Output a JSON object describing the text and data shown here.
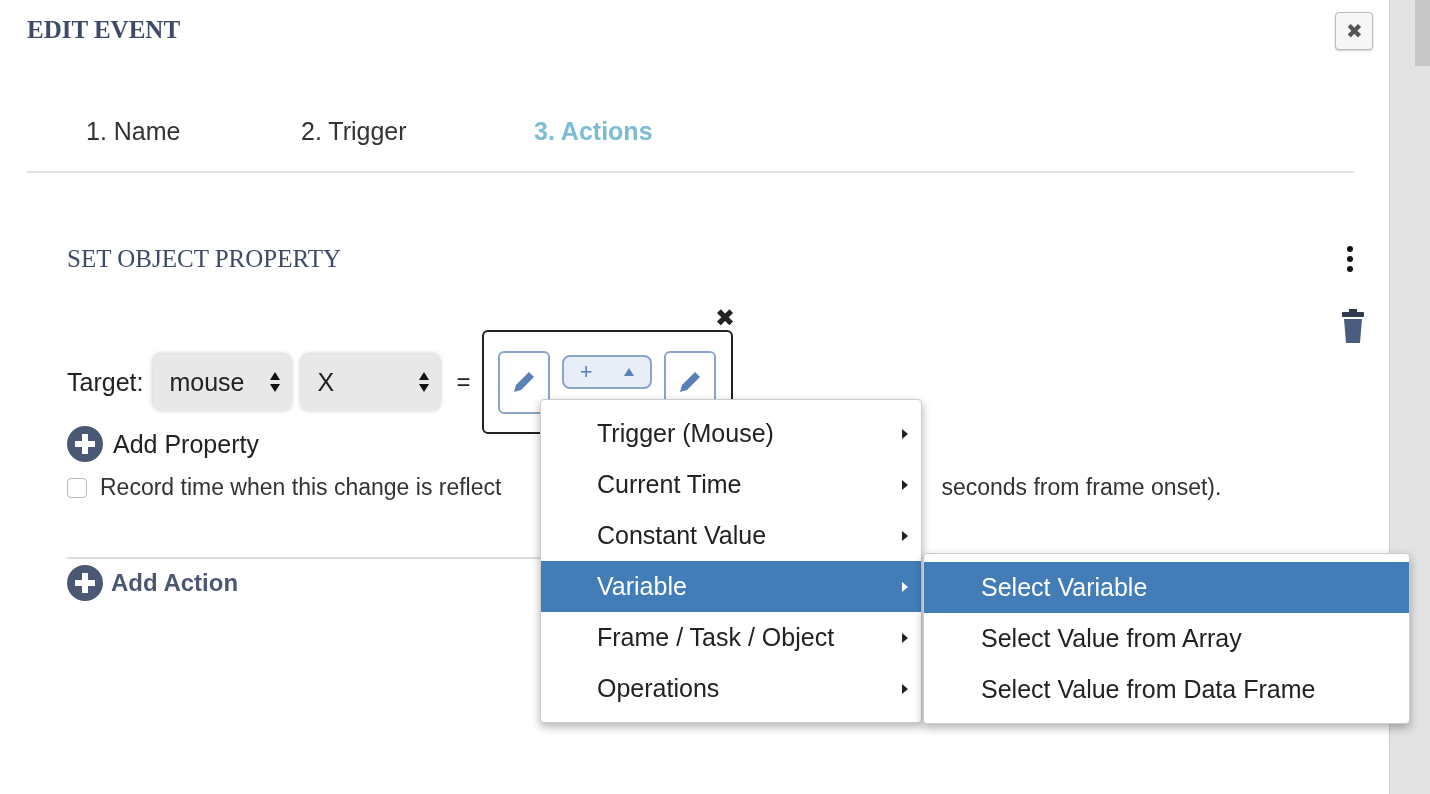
{
  "dialog": {
    "title": "EDIT EVENT",
    "close_icon": "✖"
  },
  "tabs": [
    {
      "label": "1. Name",
      "selected": false
    },
    {
      "label": "2. Trigger",
      "selected": false
    },
    {
      "label": "3. Actions",
      "selected": true
    }
  ],
  "action": {
    "title": "SET OBJECT PROPERTY",
    "target_label": "Target:",
    "object_select": "mouse",
    "property_select": "X",
    "equals": "=",
    "operator": "+",
    "remove_icon": "✖",
    "add_property": "Add Property",
    "record_checkbox": {
      "checked": false,
      "text_before": "Record time when this change is reflect",
      "text_after": "seconds from frame onset)."
    }
  },
  "add_action": "Add Action",
  "menu": [
    {
      "label": "Trigger (Mouse)",
      "selected": false
    },
    {
      "label": "Current Time",
      "selected": false
    },
    {
      "label": "Constant Value",
      "selected": false
    },
    {
      "label": "Variable",
      "selected": true
    },
    {
      "label": "Frame / Task / Object",
      "selected": false
    },
    {
      "label": "Operations",
      "selected": false
    }
  ],
  "submenu": [
    {
      "label": "Select Variable",
      "selected": true
    },
    {
      "label": "Select Value from Array",
      "selected": false
    },
    {
      "label": "Select Value from Data Frame",
      "selected": false
    }
  ]
}
